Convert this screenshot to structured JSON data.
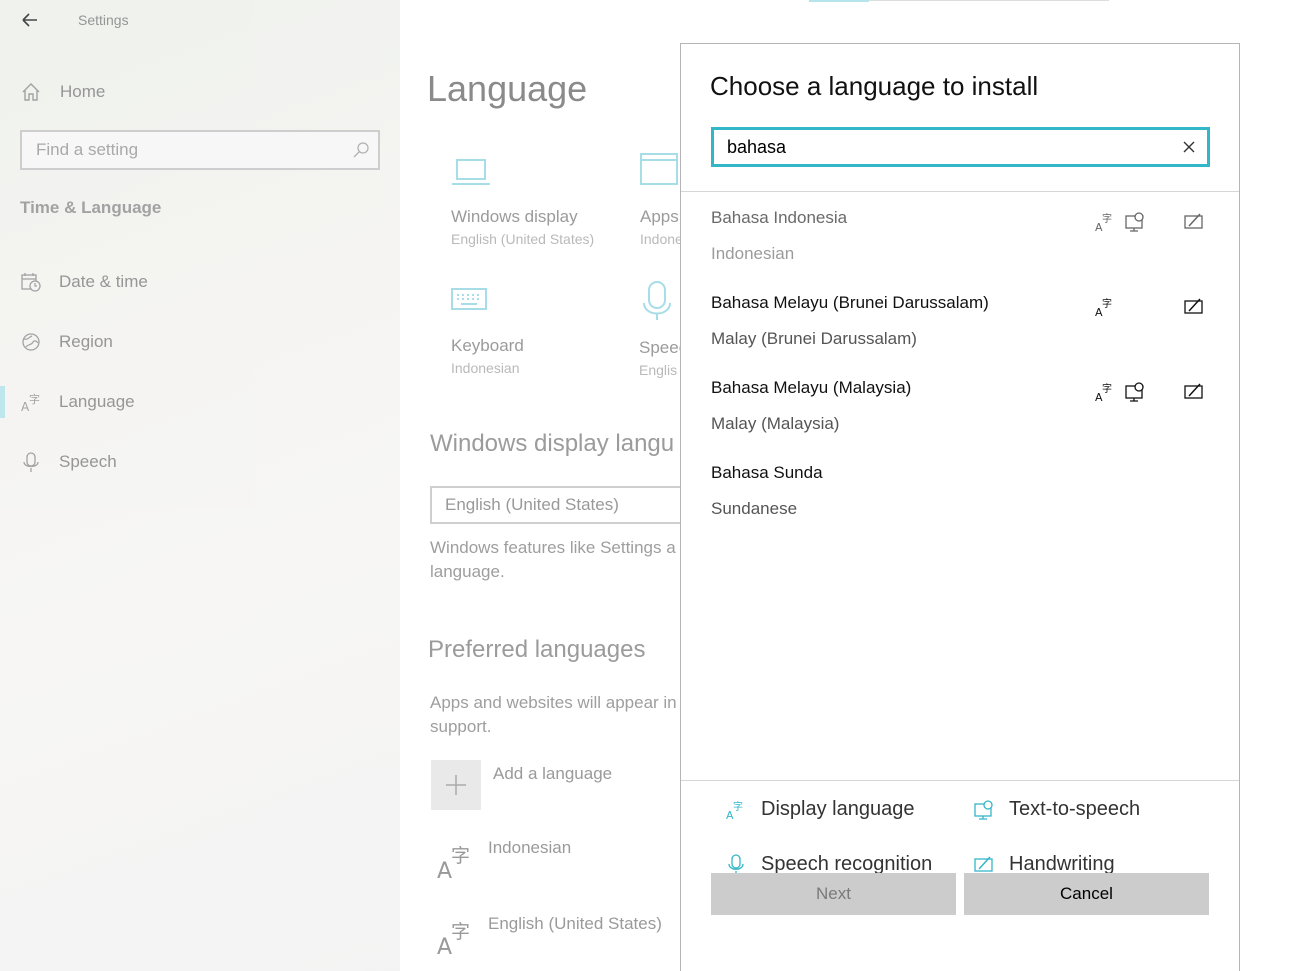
{
  "window": {
    "title": "Settings"
  },
  "sidebar": {
    "home_label": "Home",
    "search_placeholder": "Find a setting",
    "section_header": "Time & Language",
    "items": [
      {
        "label": "Date & time",
        "icon": "calendar-clock-icon"
      },
      {
        "label": "Region",
        "icon": "globe-icon"
      },
      {
        "label": "Language",
        "icon": "language-icon",
        "active": true
      },
      {
        "label": "Speech",
        "icon": "microphone-icon"
      }
    ]
  },
  "main": {
    "title": "Language",
    "tiles": [
      {
        "title": "Windows display",
        "subtitle": "English (United States)",
        "icon": "laptop-icon"
      },
      {
        "title": "Apps",
        "subtitle": "Indone",
        "icon": "window-icon"
      },
      {
        "title": "Keyboard",
        "subtitle": "Indonesian",
        "icon": "keyboard-icon"
      },
      {
        "title": "Speec",
        "subtitle": "Englis",
        "icon": "microphone-icon"
      }
    ],
    "display_lang_header": "Windows display langu",
    "display_lang_value": "English (United States)",
    "display_lang_desc_1": "Windows features like Settings a",
    "display_lang_desc_2": "language.",
    "preferred_header": "Preferred languages",
    "preferred_desc_1": "Apps and websites will appear in",
    "preferred_desc_2": "support.",
    "add_language_label": "Add a language",
    "preferred_list": [
      "Indonesian",
      "English (United States)"
    ]
  },
  "dialog": {
    "title": "Choose a language to install",
    "search_value": "bahasa",
    "results": [
      {
        "name": "Bahasa Indonesia",
        "english": "Indonesian",
        "display": true,
        "tts": true,
        "handwriting": true
      },
      {
        "name": "Bahasa Melayu (Brunei Darussalam)",
        "english": "Malay (Brunei Darussalam)",
        "display": true,
        "tts": false,
        "handwriting": true
      },
      {
        "name": "Bahasa Melayu (Malaysia)",
        "english": "Malay (Malaysia)",
        "display": true,
        "tts": true,
        "handwriting": true
      },
      {
        "name": "Bahasa Sunda",
        "english": "Sundanese",
        "display": false,
        "tts": false,
        "handwriting": false
      }
    ],
    "legend": {
      "display": "Display language",
      "tts": "Text-to-speech",
      "speech": "Speech recognition",
      "handwriting": "Handwriting"
    },
    "next_label": "Next",
    "cancel_label": "Cancel",
    "accent_color": "#34b6c9"
  }
}
